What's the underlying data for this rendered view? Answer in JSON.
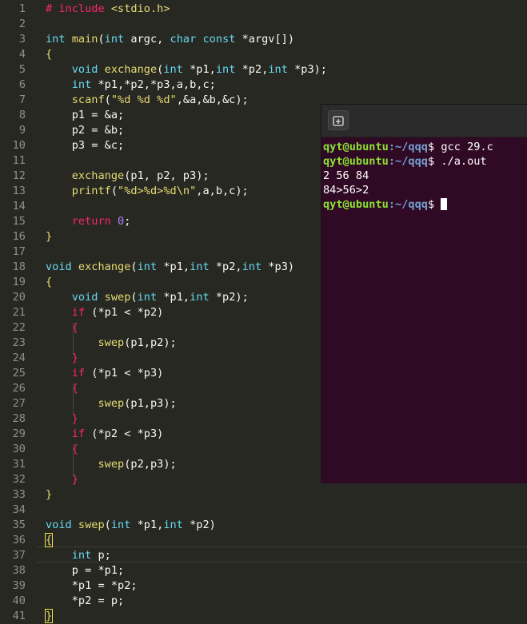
{
  "editor": {
    "lines": [
      {
        "n": "1",
        "segs": [
          [
            "# include ",
            "pre"
          ],
          [
            "<stdio.h>",
            "inc"
          ]
        ]
      },
      {
        "n": "2",
        "segs": []
      },
      {
        "n": "3",
        "segs": [
          [
            "int",
            "kw"
          ],
          [
            " main",
            "fn"
          ],
          [
            "(",
            ""
          ],
          [
            "int",
            "kw"
          ],
          [
            " argc, ",
            ""
          ],
          [
            "char",
            "kw"
          ],
          [
            " ",
            ""
          ],
          [
            "const",
            "kw"
          ],
          [
            " *argv[]",
            ""
          ],
          [
            ")",
            ""
          ]
        ]
      },
      {
        "n": "4",
        "segs": [
          [
            "{",
            "br"
          ]
        ]
      },
      {
        "n": "5",
        "segs": [
          [
            "    ",
            ""
          ],
          [
            "void",
            "kw"
          ],
          [
            " exchange",
            "fn"
          ],
          [
            "(",
            ""
          ],
          [
            "int",
            "kw"
          ],
          [
            " *p1,",
            ""
          ],
          [
            "int",
            "kw"
          ],
          [
            " *p2,",
            ""
          ],
          [
            "int",
            "kw"
          ],
          [
            " *p3);",
            ""
          ]
        ]
      },
      {
        "n": "6",
        "segs": [
          [
            "    ",
            ""
          ],
          [
            "int",
            "kw"
          ],
          [
            " *p1,*p2,*p3,a,b,c;",
            ""
          ]
        ]
      },
      {
        "n": "7",
        "segs": [
          [
            "    ",
            ""
          ],
          [
            "scanf",
            "fn"
          ],
          [
            "(",
            ""
          ],
          [
            "\"%d %d %d\"",
            "str"
          ],
          [
            ",&a,&b,&c);",
            ""
          ]
        ]
      },
      {
        "n": "8",
        "segs": [
          [
            "    p1 = &a;",
            ""
          ]
        ]
      },
      {
        "n": "9",
        "segs": [
          [
            "    p2 = &b;",
            ""
          ]
        ]
      },
      {
        "n": "10",
        "segs": [
          [
            "    p3 = &c;",
            ""
          ]
        ]
      },
      {
        "n": "11",
        "segs": []
      },
      {
        "n": "12",
        "segs": [
          [
            "    ",
            ""
          ],
          [
            "exchange",
            "fn"
          ],
          [
            "(p1, p2, p3);",
            ""
          ]
        ]
      },
      {
        "n": "13",
        "segs": [
          [
            "    ",
            ""
          ],
          [
            "printf",
            "fn"
          ],
          [
            "(",
            ""
          ],
          [
            "\"%d>%d>%d\\n\"",
            "str"
          ],
          [
            ",a,b,c);",
            ""
          ]
        ]
      },
      {
        "n": "14",
        "segs": []
      },
      {
        "n": "15",
        "segs": [
          [
            "    ",
            ""
          ],
          [
            "return",
            "pre"
          ],
          [
            " ",
            ""
          ],
          [
            "0",
            "num"
          ],
          [
            ";",
            ""
          ]
        ]
      },
      {
        "n": "16",
        "segs": [
          [
            "}",
            "br"
          ]
        ]
      },
      {
        "n": "17",
        "segs": []
      },
      {
        "n": "18",
        "segs": [
          [
            "void",
            "kw"
          ],
          [
            " exchange",
            "fn"
          ],
          [
            "(",
            ""
          ],
          [
            "int",
            "kw"
          ],
          [
            " *p1,",
            ""
          ],
          [
            "int",
            "kw"
          ],
          [
            " *p2,",
            ""
          ],
          [
            "int",
            "kw"
          ],
          [
            " *p3)",
            ""
          ]
        ]
      },
      {
        "n": "19",
        "segs": [
          [
            "{",
            "br"
          ]
        ]
      },
      {
        "n": "20",
        "segs": [
          [
            "    ",
            ""
          ],
          [
            "void",
            "kw"
          ],
          [
            " swep",
            "fn"
          ],
          [
            "(",
            ""
          ],
          [
            "int",
            "kw"
          ],
          [
            " *p1,",
            ""
          ],
          [
            "int",
            "kw"
          ],
          [
            " *p2);",
            ""
          ]
        ]
      },
      {
        "n": "21",
        "segs": [
          [
            "    ",
            ""
          ],
          [
            "if",
            "pre"
          ],
          [
            " (*p1 < *p2)",
            ""
          ]
        ]
      },
      {
        "n": "22",
        "segs": [
          [
            "    ",
            ""
          ],
          [
            "{",
            "pre"
          ]
        ]
      },
      {
        "n": "23",
        "segs": [
          [
            "        ",
            ""
          ],
          [
            "swep",
            "fn"
          ],
          [
            "(p1,p2);",
            ""
          ]
        ]
      },
      {
        "n": "24",
        "segs": [
          [
            "    ",
            ""
          ],
          [
            "}",
            "pre"
          ]
        ]
      },
      {
        "n": "25",
        "segs": [
          [
            "    ",
            ""
          ],
          [
            "if",
            "pre"
          ],
          [
            " (*p1 < *p3)",
            ""
          ]
        ]
      },
      {
        "n": "26",
        "segs": [
          [
            "    ",
            ""
          ],
          [
            "{",
            "pre"
          ]
        ]
      },
      {
        "n": "27",
        "segs": [
          [
            "        ",
            ""
          ],
          [
            "swep",
            "fn"
          ],
          [
            "(p1,p3);",
            ""
          ]
        ]
      },
      {
        "n": "28",
        "segs": [
          [
            "    ",
            ""
          ],
          [
            "}",
            "pre"
          ]
        ]
      },
      {
        "n": "29",
        "segs": [
          [
            "    ",
            ""
          ],
          [
            "if",
            "pre"
          ],
          [
            " (*p2 < *p3)",
            ""
          ]
        ]
      },
      {
        "n": "30",
        "segs": [
          [
            "    ",
            ""
          ],
          [
            "{",
            "pre"
          ]
        ]
      },
      {
        "n": "31",
        "segs": [
          [
            "        ",
            ""
          ],
          [
            "swep",
            "fn"
          ],
          [
            "(p2,p3);",
            ""
          ]
        ]
      },
      {
        "n": "32",
        "segs": [
          [
            "    ",
            ""
          ],
          [
            "}",
            "pre"
          ]
        ]
      },
      {
        "n": "33",
        "segs": [
          [
            "}",
            "br"
          ]
        ]
      },
      {
        "n": "34",
        "segs": []
      },
      {
        "n": "35",
        "segs": [
          [
            "void",
            "kw"
          ],
          [
            " swep",
            "fn"
          ],
          [
            "(",
            ""
          ],
          [
            "int",
            "kw"
          ],
          [
            " *p1,",
            ""
          ],
          [
            "int",
            "kw"
          ],
          [
            " *p2)",
            ""
          ]
        ]
      },
      {
        "n": "36",
        "segs": [
          [
            "{",
            "br cur"
          ]
        ]
      },
      {
        "n": "37",
        "segs": [
          [
            "    ",
            ""
          ],
          [
            "int",
            "kw"
          ],
          [
            " p;",
            ""
          ]
        ]
      },
      {
        "n": "38",
        "segs": [
          [
            "    p = *p1;",
            ""
          ]
        ]
      },
      {
        "n": "39",
        "segs": [
          [
            "    *p1 = *p2;",
            ""
          ]
        ]
      },
      {
        "n": "40",
        "segs": [
          [
            "    *p2 = p;",
            ""
          ]
        ]
      },
      {
        "n": "41",
        "segs": [
          [
            "}",
            "br cur"
          ]
        ]
      }
    ]
  },
  "terminal": {
    "new_tab_icon": "new-tab-icon",
    "lines": [
      {
        "user": "qyt@ubuntu",
        "path": ":~/qqq",
        "sign": "$ ",
        "cmd": "gcc 29.c"
      },
      {
        "user": "qyt@ubuntu",
        "path": ":~/qqq",
        "sign": "$ ",
        "cmd": "./a.out"
      },
      {
        "out": "2 56 84"
      },
      {
        "out": "84>56>2"
      },
      {
        "user": "qyt@ubuntu",
        "path": ":~/qqq",
        "sign": "$ ",
        "cmd": "",
        "cursor": true
      }
    ]
  },
  "colors": {
    "editor_bg": "#272822",
    "terminal_bg": "#300a24",
    "keyword": "#66d9ef",
    "function": "#e6db74",
    "control": "#f92672",
    "number": "#ae81ff",
    "prompt_user": "#8ae234",
    "prompt_path": "#729fcf"
  }
}
